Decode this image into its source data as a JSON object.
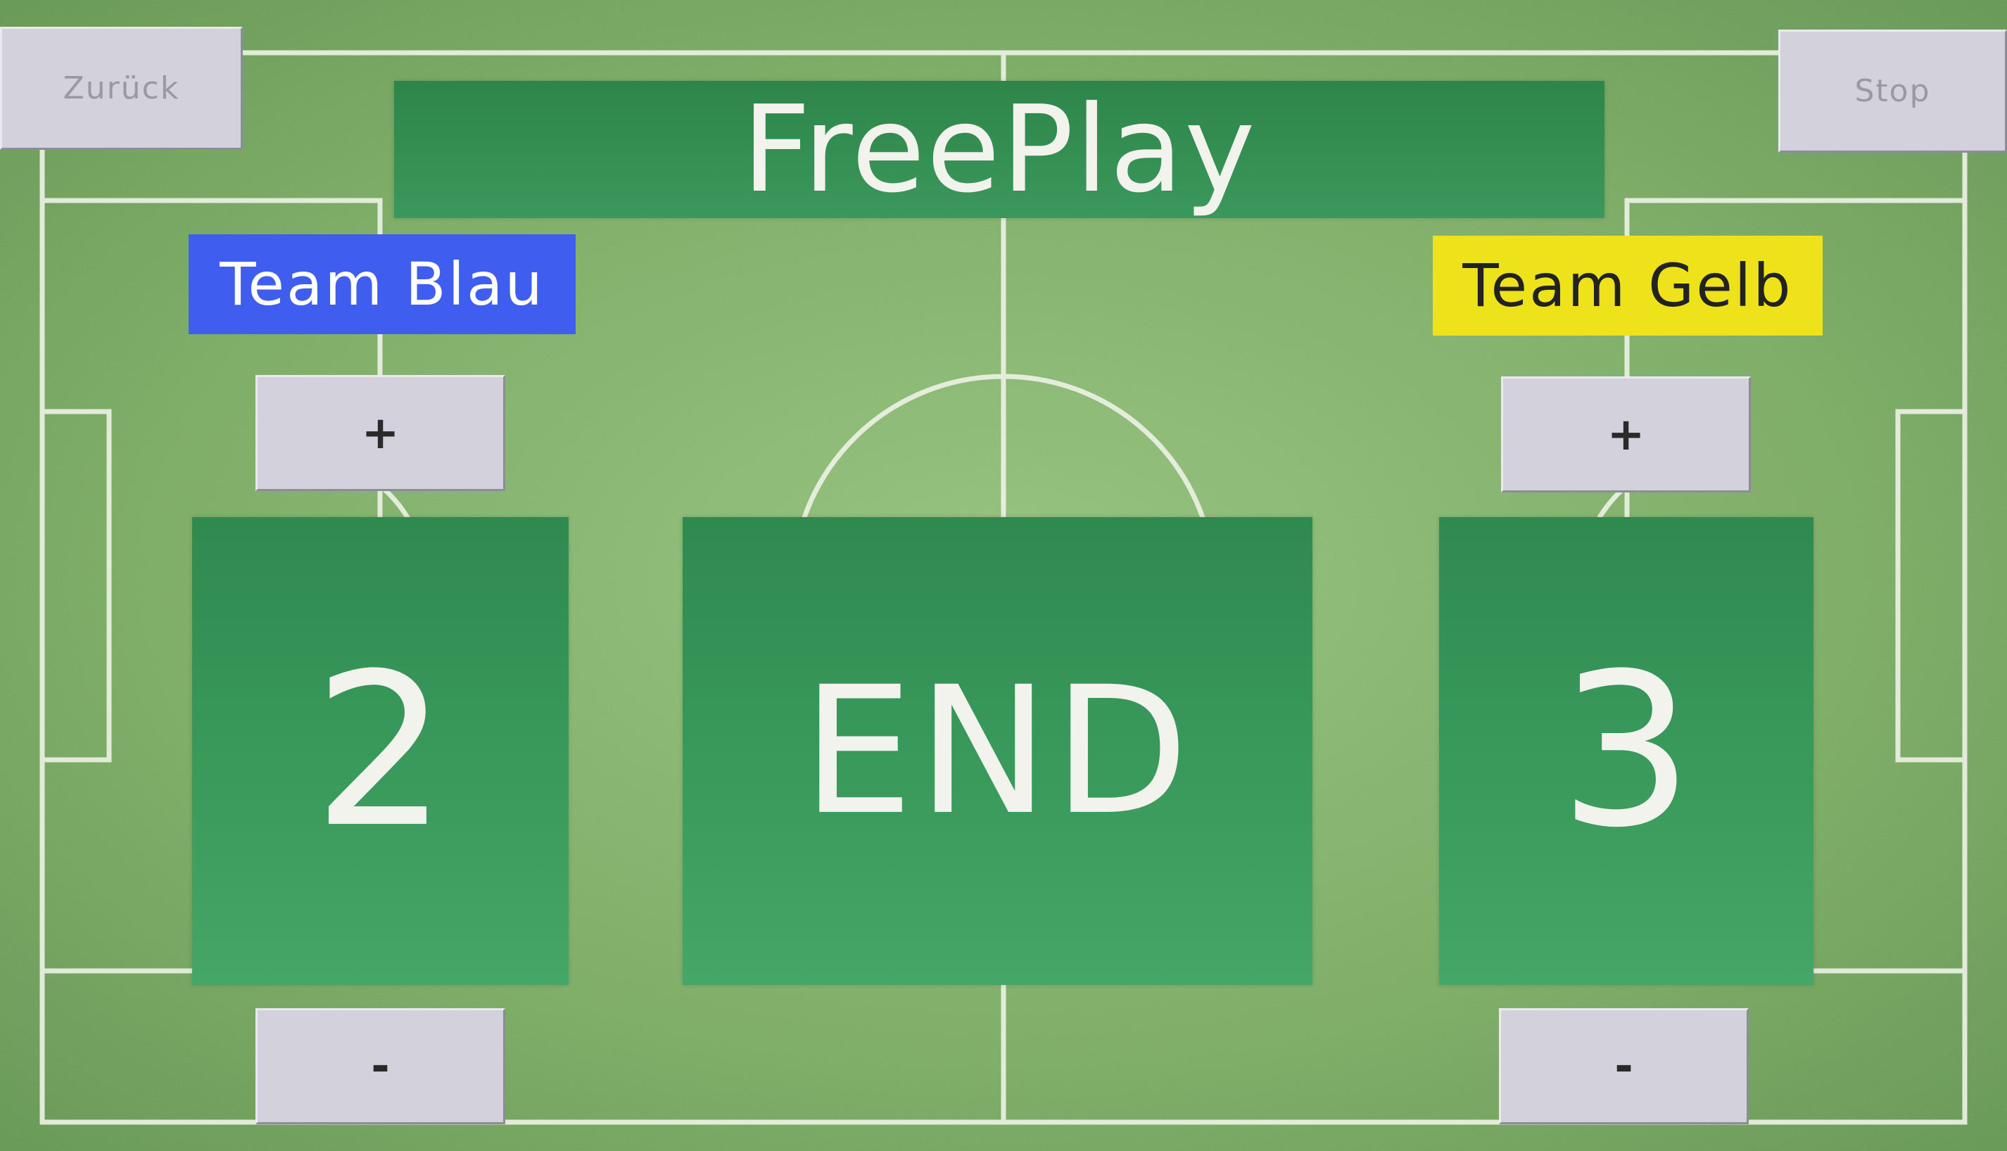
{
  "header": {
    "back_label": "Zurück",
    "stop_label": "Stop",
    "title": "FreePlay"
  },
  "teams": {
    "left": {
      "name": "Team Blau",
      "score": "2",
      "plus_label": "+",
      "minus_label": "-",
      "color": "#3f5ef0",
      "text_color": "#ffffff"
    },
    "right": {
      "name": "Team Gelb",
      "score": "3",
      "plus_label": "+",
      "minus_label": "-",
      "color": "#eee21a",
      "text_color": "#222222"
    }
  },
  "center": {
    "end_label": "END"
  },
  "colors": {
    "panel_green": "#3a9a5c",
    "button_gray": "#d3d1dc",
    "pitch_green": "#6a9e55"
  }
}
